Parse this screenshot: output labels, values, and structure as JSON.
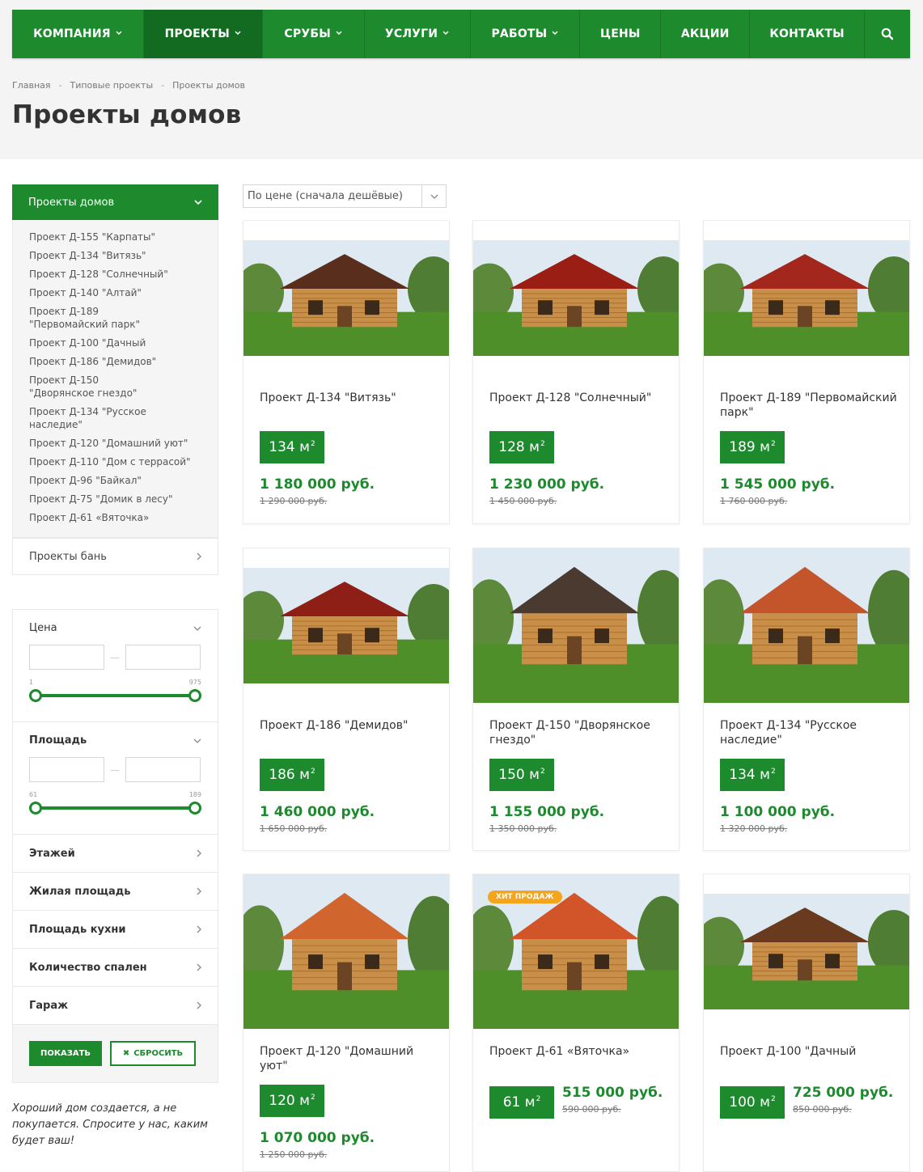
{
  "nav": {
    "items": [
      {
        "label": "КОМПАНИЯ",
        "chevron": true
      },
      {
        "label": "ПРОЕКТЫ",
        "chevron": true,
        "active": true
      },
      {
        "label": "СРУБЫ",
        "chevron": true
      },
      {
        "label": "УСЛУГИ",
        "chevron": true
      },
      {
        "label": "РАБОТЫ",
        "chevron": true
      },
      {
        "label": "ЦЕНЫ",
        "chevron": false
      },
      {
        "label": "АКЦИИ",
        "chevron": false
      },
      {
        "label": "КОНТАКТЫ",
        "chevron": false
      }
    ],
    "search_icon": "search-icon"
  },
  "breadcrumb": {
    "items": [
      "Главная",
      "Типовые проекты",
      "Проекты домов"
    ],
    "separator": "-"
  },
  "page_title": "Проекты домов",
  "sidebar": {
    "category_title": "Проекты домов",
    "category_items": [
      "Проект Д-155 \"Карпаты\"",
      "Проект Д-134 \"Витязь\"",
      "Проект Д-128 \"Солнечный\"",
      "Проект Д-140 \"Алтай\"",
      "Проект Д-189 \"Первомайский парк\"",
      "Проект Д-100 \"Дачный",
      "Проект Д-186 \"Демидов\"",
      "Проект Д-150 \"Дворянское гнездо\"",
      "Проект Д-134 \"Русское наследие\"",
      "Проект Д-120 \"Домашний уют\"",
      "Проект Д-110 \"Дом с террасой\"",
      "Проект Д-96 \"Байкал\"",
      "Проект Д-75 \"Домик в лесу\"",
      "Проект Д-61 «Вяточка»"
    ],
    "bath_title": "Проекты бань"
  },
  "filter": {
    "price": {
      "label": "Цена",
      "min": "1",
      "max": "975",
      "range_fraction": [
        0,
        1
      ]
    },
    "area": {
      "label": "Площадь",
      "min": "61",
      "max": "189",
      "range_fraction": [
        0,
        1
      ]
    },
    "rows": [
      "Этажей",
      "Жилая площадь",
      "Площадь кухни",
      "Количество спален",
      "Гараж"
    ],
    "show_button": "ПОКАЗАТЬ",
    "reset_button": "СБРОСИТЬ",
    "reset_icon": "✖"
  },
  "quote": "Хороший дом создается, а не покупается. Спросите у нас, каким будет ваш!",
  "sort": {
    "value": "По цене (сначала дешёвые)"
  },
  "unit": "м",
  "unit_power": "2",
  "cards": [
    {
      "name": "Проект Д-134 \"Витязь\"",
      "area": "134",
      "price": "1 180 000 руб.",
      "old_price": "1 290 000 руб.",
      "roof": "#5a2e1c"
    },
    {
      "name": "Проект Д-128 \"Солнечный\"",
      "area": "128",
      "price": "1 230 000 руб.",
      "old_price": "1 450 000 руб.",
      "roof": "#9a1e14"
    },
    {
      "name": "Проект Д-189 \"Первомайский парк\"",
      "area": "189",
      "price": "1 545 000 руб.",
      "old_price": "1 760 000 руб.",
      "roof": "#a3271c"
    },
    {
      "name": "Проект Д-186 \"Демидов\"",
      "area": "186",
      "price": "1 460 000 руб.",
      "old_price": "1 650 000 руб.",
      "roof": "#8e1f16"
    },
    {
      "name": "Проект Д-150 \"Дворянское гнездо\"",
      "area": "150",
      "price": "1 155 000 руб.",
      "old_price": "1 350 000 руб.",
      "roof": "#4a3a30"
    },
    {
      "name": "Проект Д-134 \"Русское наследие\"",
      "area": "134",
      "price": "1 100 000 руб.",
      "old_price": "1 320 000 руб.",
      "roof": "#c4552a"
    },
    {
      "name": "Проект Д-120 \"Домашний уют\"",
      "area": "120",
      "price": "1 070 000 руб.",
      "old_price": "1 250 000 руб.",
      "roof": "#d0662e"
    },
    {
      "name": "Проект Д-61 «Вяточка»",
      "area": "61",
      "price": "515 000 руб.",
      "old_price": "590 000 руб.",
      "roof": "#d2552a",
      "hit": "ХИТ ПРОДАЖ"
    },
    {
      "name": "Проект Д-100 \"Дачный",
      "area": "100",
      "price": "725 000 руб.",
      "old_price": "850 000 руб.",
      "roof": "#6a3a1e"
    }
  ],
  "colors": {
    "brand_green": "#1e8a2e",
    "hit_orange": "#f5a51c"
  }
}
